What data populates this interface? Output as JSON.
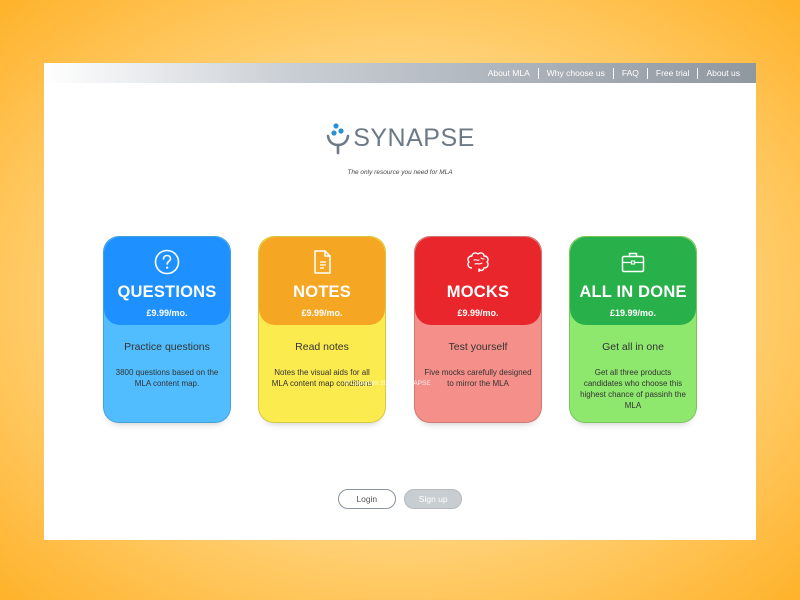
{
  "nav": {
    "items": [
      "About MLA",
      "Why choose us",
      "FAQ",
      "Free trial",
      "About us"
    ]
  },
  "brand": {
    "name": "SYNAPSE",
    "tagline": "The only resource you need for MLA"
  },
  "cards": [
    {
      "title": "QUESTIONS",
      "price": "£9.99/mo.",
      "subtitle": "Practice questions",
      "description": "3800 questions based on the MLA content map.",
      "icon": "question-circle-icon",
      "accent": "#1e90ff"
    },
    {
      "title": "NOTES",
      "price": "£9.99/mo.",
      "subtitle": "Read notes",
      "description": "Notes the visual aids for all MLA content map conditions",
      "icon": "document-icon",
      "accent": "#f5a623"
    },
    {
      "title": "MOCKS",
      "price": "£9.99/mo.",
      "subtitle": "Test yourself",
      "description": "Five mocks carefully designed to mirror the MLA",
      "icon": "brain-icon",
      "accent": "#e8262b"
    },
    {
      "title": "ALL IN DONE",
      "price": "£19.99/mo.",
      "subtitle": "Get all in one",
      "description": "Get all three products candidates who choose this highest chance of passinh the MLA",
      "icon": "briefcase-icon",
      "accent": "#28b14a"
    }
  ],
  "footer": {
    "copyright": "© Copyright 2025 | SYNAPSE"
  },
  "buttons": {
    "login": "Login",
    "signup": "Sign up"
  }
}
